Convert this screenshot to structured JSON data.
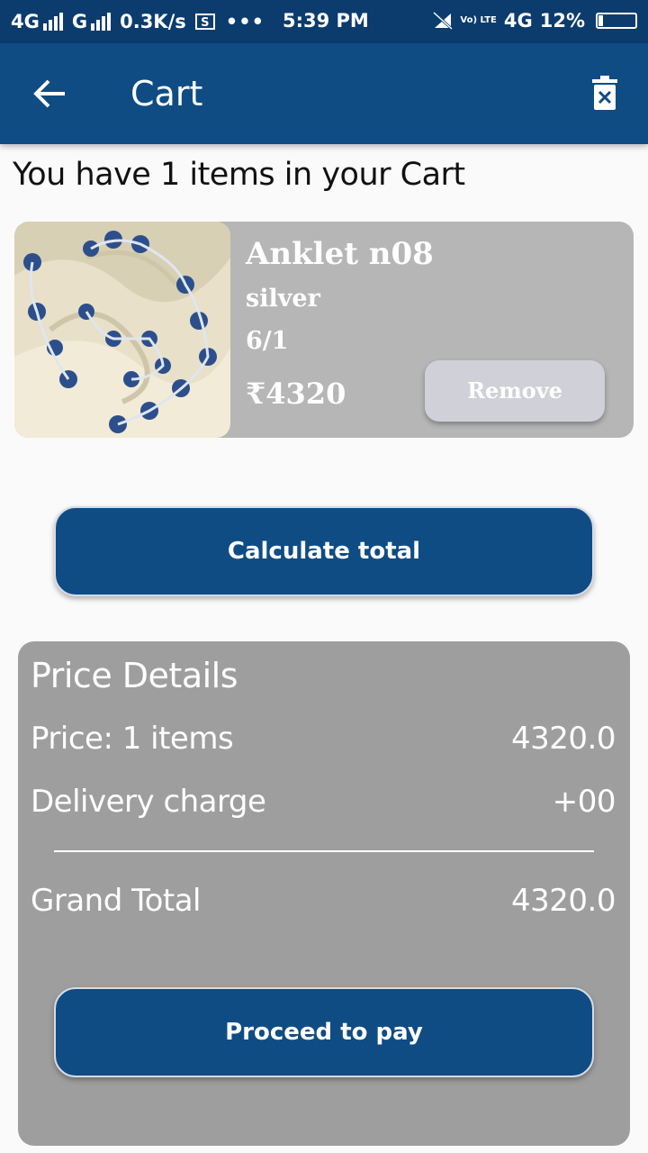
{
  "status_bar": {
    "network1": "4G",
    "network2": "G",
    "speed": "0.3K/s",
    "screen_icon": "S",
    "more": "•••",
    "time": "5:39 PM",
    "volte": "Vo) LTE",
    "network3": "4G",
    "battery": "12%",
    "battery_level": 0.12
  },
  "app_bar": {
    "title": "Cart",
    "back_icon": "arrow-left-icon",
    "delete_icon": "delete-icon"
  },
  "heading": "You have 1 items in your Cart",
  "item": {
    "name": "Anklet n08",
    "material": "silver",
    "size": "6/1",
    "price": "₹4320",
    "remove_label": "Remove"
  },
  "calculate_label": "Calculate  total",
  "price_details": {
    "title": "Price Details",
    "price_label": "Price: 1 items",
    "price_value": "4320.0",
    "delivery_label": "Delivery charge",
    "delivery_value": "+00",
    "grand_label": "Grand Total",
    "grand_value": "4320.0"
  },
  "pay_label": "Proceed to pay",
  "colors": {
    "status_bar": "#0c3c6e",
    "app_bar": "#0f4c84",
    "button": "#0f4c84",
    "item_card": "#b6b6b6",
    "remove_button": "#d0d0d8",
    "price_panel": "#9e9e9e"
  }
}
